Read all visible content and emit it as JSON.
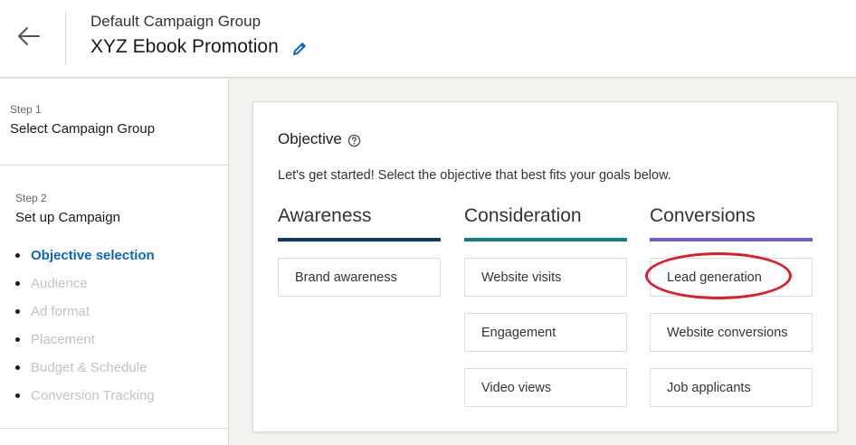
{
  "header": {
    "campaign_group": "Default Campaign Group",
    "campaign_name": "XYZ Ebook Promotion"
  },
  "sidebar": {
    "step1": {
      "label": "Step 1",
      "title": "Select Campaign Group"
    },
    "step2": {
      "label": "Step 2",
      "title": "Set up Campaign",
      "items": [
        {
          "label": "Objective selection",
          "active": true
        },
        {
          "label": "Audience",
          "active": false
        },
        {
          "label": "Ad format",
          "active": false
        },
        {
          "label": "Placement",
          "active": false
        },
        {
          "label": "Budget & Schedule",
          "active": false
        },
        {
          "label": "Conversion Tracking",
          "active": false
        }
      ]
    }
  },
  "objective": {
    "title": "Objective",
    "subtitle": "Let's get started! Select the objective that best fits your goals below.",
    "columns": [
      {
        "heading": "Awareness",
        "color": "#0b3c6b",
        "options": [
          "Brand awareness"
        ]
      },
      {
        "heading": "Consideration",
        "color": "#0f7e86",
        "options": [
          "Website visits",
          "Engagement",
          "Video views"
        ]
      },
      {
        "heading": "Conversions",
        "color": "#6c5dd3",
        "options": [
          "Lead generation",
          "Website conversions",
          "Job applicants"
        ]
      }
    ]
  },
  "colors": {
    "accent": "#0a66c2",
    "highlight_circle": "#e01c2a"
  }
}
